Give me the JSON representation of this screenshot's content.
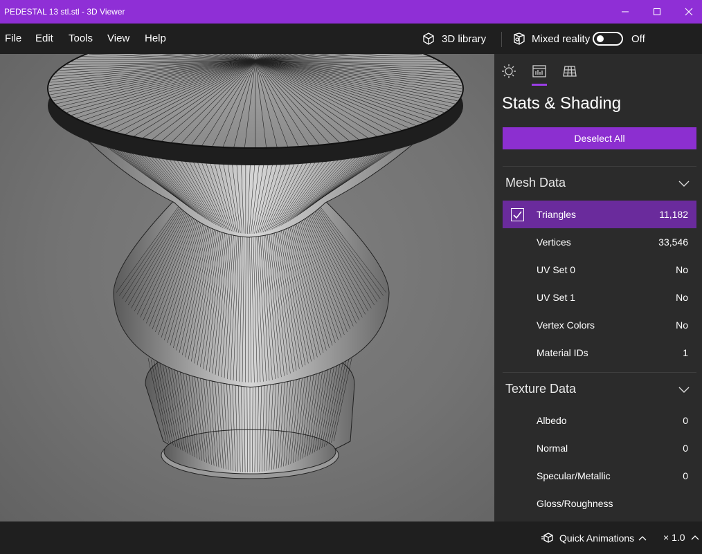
{
  "window": {
    "title": "PEDESTAL 13 stl.stl - 3D Viewer",
    "accent_color": "#8f2fd6"
  },
  "menu": {
    "items": [
      "File",
      "Edit",
      "Tools",
      "View",
      "Help"
    ],
    "library_label": "3D library",
    "mixed_reality_label": "Mixed reality",
    "mixed_reality_state": "Off"
  },
  "panel": {
    "tabs": [
      "lighting-icon",
      "stats-icon",
      "grid-icon"
    ],
    "title": "Stats & Shading",
    "deselect_label": "Deselect All",
    "mesh_section": "Mesh Data",
    "mesh_rows": [
      {
        "label": "Triangles",
        "value": "11,182",
        "checked": true
      },
      {
        "label": "Vertices",
        "value": "33,546"
      },
      {
        "label": "UV Set 0",
        "value": "No"
      },
      {
        "label": "UV Set 1",
        "value": "No"
      },
      {
        "label": "Vertex Colors",
        "value": "No"
      },
      {
        "label": "Material IDs",
        "value": "1"
      }
    ],
    "texture_section": "Texture Data",
    "texture_rows": [
      {
        "label": "Albedo",
        "value": "0"
      },
      {
        "label": "Normal",
        "value": "0"
      },
      {
        "label": "Specular/Metallic",
        "value": "0"
      },
      {
        "label": "Gloss/Roughness",
        "value": ""
      }
    ]
  },
  "statusbar": {
    "animations_label": "Quick Animations",
    "speed_label": "× 1.0"
  }
}
